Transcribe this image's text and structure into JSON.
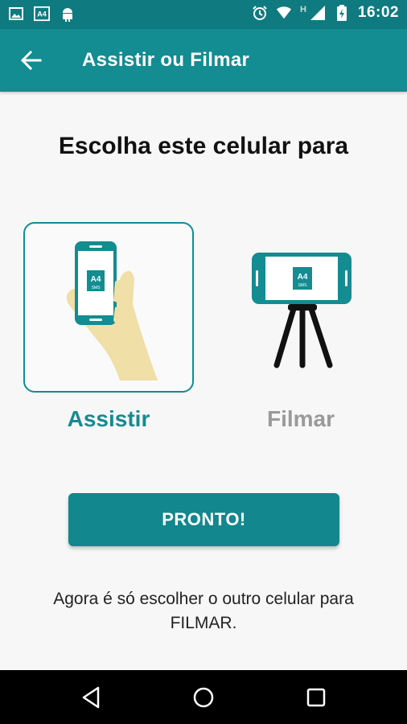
{
  "status_bar": {
    "time": "16:02",
    "left_icons": [
      "image-icon",
      "a4-app-icon",
      "android-icon"
    ],
    "right_icons": [
      "alarm-icon",
      "wifi-icon",
      "signal-icon",
      "battery-icon"
    ],
    "network_letter": "H"
  },
  "toolbar": {
    "title": "Assistir ou Filmar"
  },
  "main": {
    "prompt": "Escolha este celular para",
    "options": [
      {
        "label": "Assistir",
        "selected": true,
        "logo_text": "A4",
        "logo_sub": "SMS"
      },
      {
        "label": "Filmar",
        "selected": false,
        "logo_text": "A4",
        "logo_sub": "SMS"
      }
    ],
    "button_label": "PRONTO!",
    "hint": "Agora é só escolher o outro celular para FILMAR."
  },
  "colors": {
    "primary": "#138c92",
    "status_bar": "#0f7a7f",
    "selected_label": "#168a90",
    "unselected_label": "#9a9a9a",
    "hand": "#f0dfa6"
  }
}
